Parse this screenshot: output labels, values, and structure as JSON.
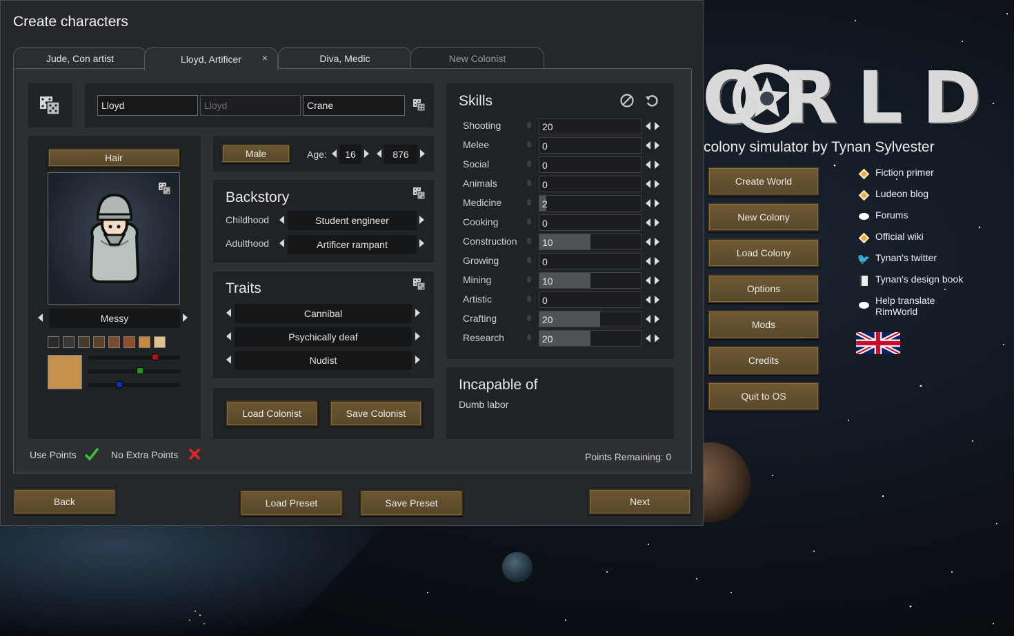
{
  "logo_text": "ORLD",
  "tagline": "colony simulator by Tynan Sylvester",
  "main_menu": [
    "Create World",
    "New Colony",
    "Load Colony",
    "Options",
    "Mods",
    "Credits",
    "Quit to OS"
  ],
  "links": [
    {
      "label": "Fiction primer",
      "icon": "diamond-icon"
    },
    {
      "label": "Ludeon blog",
      "icon": "diamond-icon"
    },
    {
      "label": "Forums",
      "icon": "speech-bubble-icon"
    },
    {
      "label": "Official wiki",
      "icon": "diamond-icon"
    },
    {
      "label": "Tynan's twitter",
      "icon": "twitter-bird-icon"
    },
    {
      "label": "Tynan's design book",
      "icon": "book-icon"
    },
    {
      "label": "Help translate RimWorld",
      "icon": "speech-bubble-icon"
    }
  ],
  "dialog": {
    "title": "Create characters",
    "tabs": [
      {
        "label": "Jude, Con artist"
      },
      {
        "label": "Lloyd, Artificer",
        "close": "×"
      },
      {
        "label": "Diva, Medic"
      },
      {
        "label": "New Colonist"
      }
    ],
    "name": {
      "first": "Lloyd",
      "nick_placeholder": "Lloyd",
      "last": "Crane"
    },
    "hair_button": "Hair",
    "hair_style": "Messy",
    "skin_swatches": [
      "#2a2a2a",
      "#3a3633",
      "#4a3a2c",
      "#5c4128",
      "#7a4b2b",
      "#8f4e2a",
      "#c7893f",
      "#e4c08f"
    ],
    "selected_skin": "#c4924d",
    "gender_button": "Male",
    "age_label": "Age:",
    "bio_age": "16",
    "chrono_age": "876",
    "backstory": {
      "title": "Backstory",
      "childhood_label": "Childhood",
      "childhood": "Student engineer",
      "adulthood_label": "Adulthood",
      "adulthood": "Artificer rampant"
    },
    "traits": {
      "title": "Traits",
      "items": [
        "Cannibal",
        "Psychically deaf",
        "Nudist"
      ]
    },
    "load_colonist": "Load Colonist",
    "save_colonist": "Save Colonist",
    "skills_title": "Skills",
    "skills": [
      {
        "name": "Shooting",
        "value": "20",
        "level": 20
      },
      {
        "name": "Melee",
        "value": "0",
        "level": 0
      },
      {
        "name": "Social",
        "value": "0",
        "level": 0
      },
      {
        "name": "Animals",
        "value": "0",
        "level": 0
      },
      {
        "name": "Medicine",
        "value": "2",
        "level": 2
      },
      {
        "name": "Cooking",
        "value": "0",
        "level": 0
      },
      {
        "name": "Construction",
        "value": "10",
        "level": 10
      },
      {
        "name": "Growing",
        "value": "0",
        "level": 0
      },
      {
        "name": "Mining",
        "value": "10",
        "level": 10
      },
      {
        "name": "Artistic",
        "value": "0",
        "level": 0
      },
      {
        "name": "Crafting",
        "value": "20",
        "level": 20
      },
      {
        "name": "Research",
        "value": "20",
        "level": 20
      }
    ],
    "skill_fill_levels": {
      "Shooting": 0.0,
      "Medicine": 0.07,
      "Construction": 0.5,
      "Mining": 0.5,
      "Crafting": 0.6,
      "Research": 0.5
    },
    "incapable_title": "Incapable of",
    "incapable": "Dumb labor",
    "use_points": "Use Points",
    "no_extra_points": "No Extra Points",
    "points_remaining": "Points Remaining: 0",
    "back": "Back",
    "load_preset": "Load Preset",
    "save_preset": "Save Preset",
    "next": "Next"
  }
}
